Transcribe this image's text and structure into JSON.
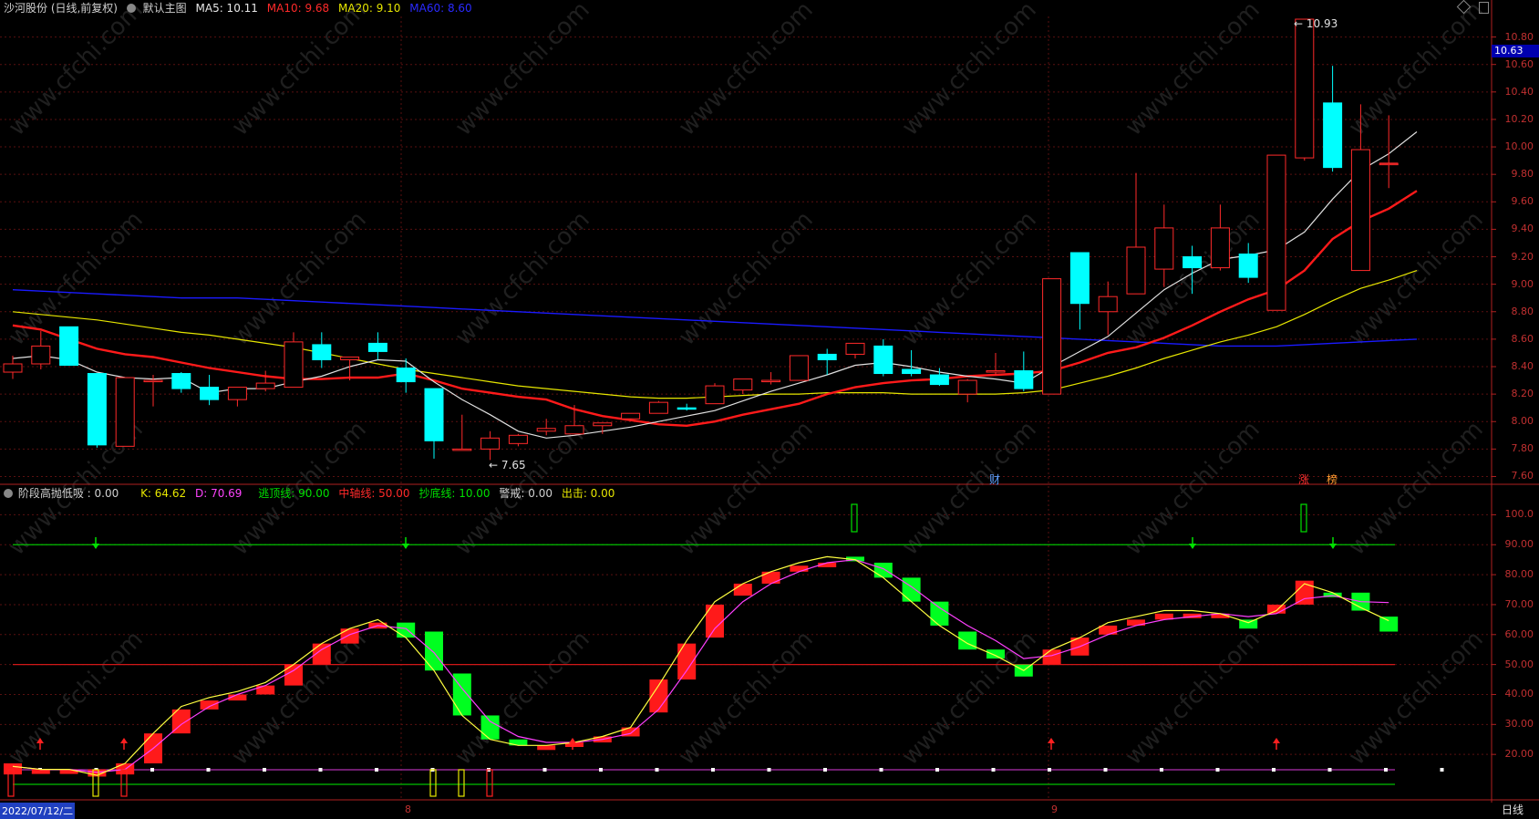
{
  "header": {
    "stock_title": "沙河股份 (日线,前复权)",
    "main_label": "默认主图",
    "ma5": "MA5: 10.11",
    "ma10": "MA10: 9.68",
    "ma20": "MA20: 9.10",
    "ma60": "MA60: 8.60"
  },
  "indicator_header": {
    "name": "阶段高抛低吸 : 0.00",
    "k": "K: 64.62",
    "d": "D: 70.69",
    "escape": "逃顶线: 90.00",
    "mid": "中轴线: 50.00",
    "bottom": "抄底线: 10.00",
    "alert": "警戒: 0.00",
    "exit": "出击: 0.00"
  },
  "price_axis": [
    "10.80",
    "10.60",
    "10.40",
    "10.20",
    "10.00",
    "9.80",
    "9.60",
    "9.40",
    "9.20",
    "9.00",
    "8.80",
    "8.60",
    "8.40",
    "8.20",
    "8.00",
    "7.80",
    "7.60"
  ],
  "current_price_tag": "10.63",
  "ind_axis": [
    "100.0",
    "90.00",
    "80.00",
    "70.00",
    "60.00",
    "50.00",
    "40.00",
    "30.00",
    "20.00"
  ],
  "annotations": {
    "high": "10.93",
    "low": "7.65",
    "cai": "财",
    "zhang": "涨",
    "bang": "榜"
  },
  "bottom_bar": {
    "date": "2022/07/12/二",
    "m8": "8",
    "m9": "9",
    "period": "日线"
  },
  "watermark": "www.cfchi.com",
  "colors": {
    "up": "#ff2a2a",
    "down": "#00ffff",
    "ma5": "#e0e0e0",
    "ma10": "#ff1a1a",
    "ma20": "#e6e600",
    "ma60": "#1a1aff"
  },
  "chart_data": [
    {
      "type": "candlestick",
      "ylim": [
        7.55,
        10.95
      ],
      "candles": [
        {
          "o": 8.36,
          "h": 8.48,
          "l": 8.31,
          "c": 8.42
        },
        {
          "o": 8.42,
          "h": 8.66,
          "l": 8.38,
          "c": 8.55
        },
        {
          "o": 8.69,
          "h": 8.69,
          "l": 8.41,
          "c": 8.41
        },
        {
          "o": 8.35,
          "h": 8.35,
          "l": 7.81,
          "c": 7.83
        },
        {
          "o": 7.82,
          "h": 8.32,
          "l": 7.82,
          "c": 8.32
        },
        {
          "o": 8.3,
          "h": 8.34,
          "l": 8.11,
          "c": 8.3
        },
        {
          "o": 8.35,
          "h": 8.36,
          "l": 8.21,
          "c": 8.24
        },
        {
          "o": 8.25,
          "h": 8.34,
          "l": 8.12,
          "c": 8.16
        },
        {
          "o": 8.16,
          "h": 8.24,
          "l": 8.11,
          "c": 8.25
        },
        {
          "o": 8.24,
          "h": 8.37,
          "l": 8.22,
          "c": 8.28
        },
        {
          "o": 8.25,
          "h": 8.65,
          "l": 8.25,
          "c": 8.58
        },
        {
          "o": 8.56,
          "h": 8.65,
          "l": 8.39,
          "c": 8.45
        },
        {
          "o": 8.45,
          "h": 8.47,
          "l": 8.3,
          "c": 8.47
        },
        {
          "o": 8.57,
          "h": 8.65,
          "l": 8.45,
          "c": 8.51
        },
        {
          "o": 8.39,
          "h": 8.46,
          "l": 8.21,
          "c": 8.29
        },
        {
          "o": 8.24,
          "h": 8.24,
          "l": 7.73,
          "c": 7.86
        },
        {
          "o": 7.79,
          "h": 8.05,
          "l": 7.79,
          "c": 7.8
        },
        {
          "o": 7.8,
          "h": 7.93,
          "l": 7.72,
          "c": 7.88
        },
        {
          "o": 7.84,
          "h": 7.91,
          "l": 7.82,
          "c": 7.9
        },
        {
          "o": 7.93,
          "h": 8.02,
          "l": 7.9,
          "c": 7.95
        },
        {
          "o": 7.91,
          "h": 8.12,
          "l": 7.91,
          "c": 7.97
        },
        {
          "o": 7.97,
          "h": 7.99,
          "l": 7.91,
          "c": 7.99
        },
        {
          "o": 8.02,
          "h": 8.06,
          "l": 8.01,
          "c": 8.06
        },
        {
          "o": 8.06,
          "h": 8.15,
          "l": 8.06,
          "c": 8.14
        },
        {
          "o": 8.1,
          "h": 8.13,
          "l": 8.08,
          "c": 8.09
        },
        {
          "o": 8.13,
          "h": 8.28,
          "l": 8.13,
          "c": 8.26
        },
        {
          "o": 8.23,
          "h": 8.31,
          "l": 8.2,
          "c": 8.31
        },
        {
          "o": 8.3,
          "h": 8.36,
          "l": 8.27,
          "c": 8.3
        },
        {
          "o": 8.3,
          "h": 8.48,
          "l": 8.3,
          "c": 8.48
        },
        {
          "o": 8.49,
          "h": 8.53,
          "l": 8.34,
          "c": 8.45
        },
        {
          "o": 8.49,
          "h": 8.57,
          "l": 8.46,
          "c": 8.57
        },
        {
          "o": 8.55,
          "h": 8.6,
          "l": 8.33,
          "c": 8.35
        },
        {
          "o": 8.38,
          "h": 8.52,
          "l": 8.33,
          "c": 8.35
        },
        {
          "o": 8.34,
          "h": 8.39,
          "l": 8.26,
          "c": 8.27
        },
        {
          "o": 8.2,
          "h": 8.31,
          "l": 8.14,
          "c": 8.3
        },
        {
          "o": 8.37,
          "h": 8.5,
          "l": 8.34,
          "c": 8.37
        },
        {
          "o": 8.37,
          "h": 8.51,
          "l": 8.22,
          "c": 8.24
        },
        {
          "o": 8.2,
          "h": 9.04,
          "l": 8.2,
          "c": 9.04
        },
        {
          "o": 9.23,
          "h": 9.23,
          "l": 8.67,
          "c": 8.86
        },
        {
          "o": 8.8,
          "h": 9.02,
          "l": 8.63,
          "c": 8.91
        },
        {
          "o": 8.93,
          "h": 9.81,
          "l": 8.93,
          "c": 9.27
        },
        {
          "o": 9.11,
          "h": 9.58,
          "l": 8.98,
          "c": 9.41
        },
        {
          "o": 9.2,
          "h": 9.28,
          "l": 8.93,
          "c": 9.12
        },
        {
          "o": 9.12,
          "h": 9.58,
          "l": 9.1,
          "c": 9.41
        },
        {
          "o": 9.22,
          "h": 9.3,
          "l": 9.01,
          "c": 9.05
        },
        {
          "o": 8.81,
          "h": 9.94,
          "l": 8.81,
          "c": 9.94
        },
        {
          "o": 9.92,
          "h": 10.93,
          "l": 9.9,
          "c": 10.93
        },
        {
          "o": 10.32,
          "h": 10.59,
          "l": 9.82,
          "c": 9.85
        },
        {
          "o": 9.1,
          "h": 10.31,
          "l": 9.1,
          "c": 9.98
        },
        {
          "o": 9.88,
          "h": 10.23,
          "l": 9.7,
          "c": 9.88
        }
      ],
      "ma5": [
        8.46,
        8.48,
        8.45,
        8.36,
        8.32,
        8.31,
        8.32,
        8.21,
        8.24,
        8.24,
        8.29,
        8.33,
        8.4,
        8.45,
        8.44,
        8.29,
        8.16,
        8.05,
        7.93,
        7.88,
        7.9,
        7.93,
        7.96,
        8.0,
        8.04,
        8.08,
        8.15,
        8.22,
        8.28,
        8.34,
        8.41,
        8.43,
        8.4,
        8.36,
        8.33,
        8.31,
        8.28,
        8.4,
        8.51,
        8.62,
        8.79,
        8.96,
        9.08,
        9.18,
        9.21,
        9.25,
        9.38,
        9.62,
        9.83,
        9.95,
        10.11
      ],
      "ma10": [
        8.7,
        8.67,
        8.6,
        8.53,
        8.49,
        8.47,
        8.43,
        8.39,
        8.36,
        8.33,
        8.31,
        8.31,
        8.32,
        8.32,
        8.35,
        8.3,
        8.24,
        8.21,
        8.18,
        8.16,
        8.09,
        8.04,
        8.01,
        7.98,
        7.97,
        8.0,
        8.05,
        8.09,
        8.13,
        8.2,
        8.25,
        8.28,
        8.3,
        8.31,
        8.33,
        8.34,
        8.35,
        8.37,
        8.43,
        8.5,
        8.54,
        8.61,
        8.7,
        8.8,
        8.89,
        8.96,
        9.1,
        9.33,
        9.46,
        9.55,
        9.68
      ],
      "ma20": [
        8.8,
        8.78,
        8.76,
        8.74,
        8.71,
        8.68,
        8.65,
        8.63,
        8.6,
        8.57,
        8.54,
        8.5,
        8.46,
        8.42,
        8.38,
        8.35,
        8.32,
        8.29,
        8.26,
        8.24,
        8.22,
        8.2,
        8.18,
        8.17,
        8.17,
        8.18,
        8.19,
        8.2,
        8.2,
        8.21,
        8.21,
        8.21,
        8.2,
        8.2,
        8.2,
        8.2,
        8.21,
        8.23,
        8.28,
        8.33,
        8.39,
        8.46,
        8.52,
        8.58,
        8.63,
        8.69,
        8.78,
        8.88,
        8.97,
        9.03,
        9.1
      ],
      "ma60": [
        8.96,
        8.95,
        8.94,
        8.93,
        8.92,
        8.91,
        8.9,
        8.9,
        8.9,
        8.89,
        8.88,
        8.87,
        8.86,
        8.85,
        8.84,
        8.83,
        8.82,
        8.81,
        8.8,
        8.79,
        8.78,
        8.77,
        8.76,
        8.75,
        8.74,
        8.73,
        8.72,
        8.71,
        8.7,
        8.69,
        8.68,
        8.67,
        8.66,
        8.65,
        8.64,
        8.63,
        8.62,
        8.61,
        8.6,
        8.59,
        8.58,
        8.57,
        8.56,
        8.55,
        8.55,
        8.55,
        8.56,
        8.57,
        8.58,
        8.59,
        8.6
      ]
    },
    {
      "type": "bar",
      "ylim": [
        10,
        105
      ],
      "bars": [
        {
          "a": 13.3,
          "b": 17.0
        },
        {
          "a": 15.0,
          "b": 15.0
        },
        {
          "a": 15.0,
          "b": 15.0
        },
        {
          "a": 12.6,
          "b": 15.0
        },
        {
          "a": 13.3,
          "b": 17.0
        },
        {
          "a": 17.0,
          "b": 27.0
        },
        {
          "a": 27.0,
          "b": 35.0
        },
        {
          "a": 35.0,
          "b": 38.0
        },
        {
          "a": 38.0,
          "b": 40.0
        },
        {
          "a": 40.0,
          "b": 43.0
        },
        {
          "a": 43.0,
          "b": 50.0
        },
        {
          "a": 50.0,
          "b": 57.0
        },
        {
          "a": 57.0,
          "b": 62.0
        },
        {
          "a": 62.0,
          "b": 64.0
        },
        {
          "a": 64.0,
          "b": 59.0
        },
        {
          "a": 61.0,
          "b": 48.0
        },
        {
          "a": 47.0,
          "b": 33.0
        },
        {
          "a": 33.0,
          "b": 25.0
        },
        {
          "a": 25.0,
          "b": 23.0
        },
        {
          "a": 23.0,
          "b": 23.0
        },
        {
          "a": 23.0,
          "b": 24.0
        },
        {
          "a": 24.0,
          "b": 26.0
        },
        {
          "a": 26.0,
          "b": 29.0
        },
        {
          "a": 34.0,
          "b": 45.0
        },
        {
          "a": 45.0,
          "b": 57.0
        },
        {
          "a": 59.0,
          "b": 70.0
        },
        {
          "a": 73.0,
          "b": 77.0
        },
        {
          "a": 77.0,
          "b": 81.0
        },
        {
          "a": 81.0,
          "b": 83.0
        },
        {
          "a": 83.0,
          "b": 84.0
        },
        {
          "a": 86.0,
          "b": 85.0
        },
        {
          "a": 84.0,
          "b": 79.0
        },
        {
          "a": 79.0,
          "b": 71.0
        },
        {
          "a": 71.0,
          "b": 63.0
        },
        {
          "a": 61.0,
          "b": 55.0
        },
        {
          "a": 55.0,
          "b": 52.0
        },
        {
          "a": 50.0,
          "b": 46.0
        },
        {
          "a": 50.0,
          "b": 55.0
        },
        {
          "a": 53.0,
          "b": 59.0
        },
        {
          "a": 60.0,
          "b": 63.0
        },
        {
          "a": 63.0,
          "b": 65.0
        },
        {
          "a": 65.0,
          "b": 67.0
        },
        {
          "a": 67.0,
          "b": 67.0
        },
        {
          "a": 67.0,
          "b": 67.0
        },
        {
          "a": 65.0,
          "b": 62.0
        },
        {
          "a": 67.0,
          "b": 70.0
        },
        {
          "a": 70.0,
          "b": 78.0
        },
        {
          "a": 74.0,
          "b": 73.0
        },
        {
          "a": 74.0,
          "b": 68.0
        },
        {
          "a": 66.0,
          "b": 61.0
        }
      ],
      "k": [
        16,
        15,
        15,
        13,
        17,
        27,
        36,
        39,
        41,
        44,
        50,
        57,
        62,
        65,
        59,
        48,
        33,
        25,
        23,
        23,
        24,
        26,
        29,
        43,
        58,
        71,
        77,
        81,
        84,
        86,
        85,
        79,
        71,
        63,
        57,
        53,
        48,
        55,
        59,
        64,
        66,
        68,
        68,
        67,
        64,
        68,
        77,
        74,
        69,
        64.62
      ],
      "d": [
        16,
        15,
        15,
        14,
        15,
        22,
        30,
        36,
        40,
        43,
        48,
        55,
        60,
        63,
        62,
        54,
        42,
        31,
        26,
        24,
        24,
        25,
        27,
        35,
        48,
        62,
        71,
        77,
        81,
        84,
        85,
        82,
        76,
        69,
        63,
        58,
        52,
        53,
        56,
        60,
        63,
        65,
        66,
        67,
        66,
        67,
        72,
        73,
        71,
        70.69
      ],
      "escape_line": 90,
      "mid_line": 50,
      "bottom_line": 10
    }
  ]
}
